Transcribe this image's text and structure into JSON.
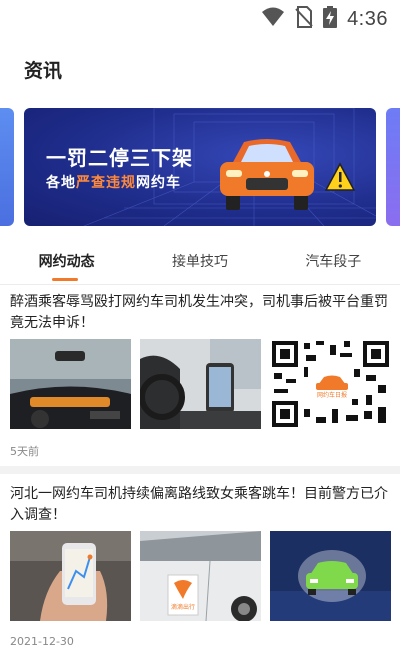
{
  "status_bar": {
    "time": "4:36",
    "icons": [
      "wifi-icon",
      "no-sim-icon",
      "battery-charging-icon"
    ]
  },
  "header": {
    "title": "资讯"
  },
  "banner": {
    "headline": "一罚二停三下架",
    "subtitle_prefix": "各地",
    "subtitle_highlight": "严查违规",
    "subtitle_suffix": "网约车",
    "colors": {
      "background": "#1f2d8c",
      "highlight": "#ff8a3d",
      "car": "#f07a2a"
    }
  },
  "tabs": [
    {
      "label": "网约动态",
      "active": true
    },
    {
      "label": "接单技巧",
      "active": false
    },
    {
      "label": "汽车段子",
      "active": false
    }
  ],
  "articles": [
    {
      "title": "醉酒乘客辱骂殴打网约车司机发生冲突，司机事后被平台重罚竟无法申诉！",
      "time": "5天前",
      "thumbnails": [
        "dashboard-camera-image",
        "phone-holder-image",
        "qr-code-image"
      ],
      "qr_caption": "网约车日报"
    },
    {
      "title": "河北一网约车司机持续偏离路线致女乘客跳车！目前警方已介入调查！",
      "time": "2021-12-30",
      "thumbnails": [
        "hand-phone-map-image",
        "didi-car-door-image",
        "green-car-image"
      ],
      "door_logo_text": "滴滴出行"
    }
  ],
  "accent_color": "#f07a2a"
}
